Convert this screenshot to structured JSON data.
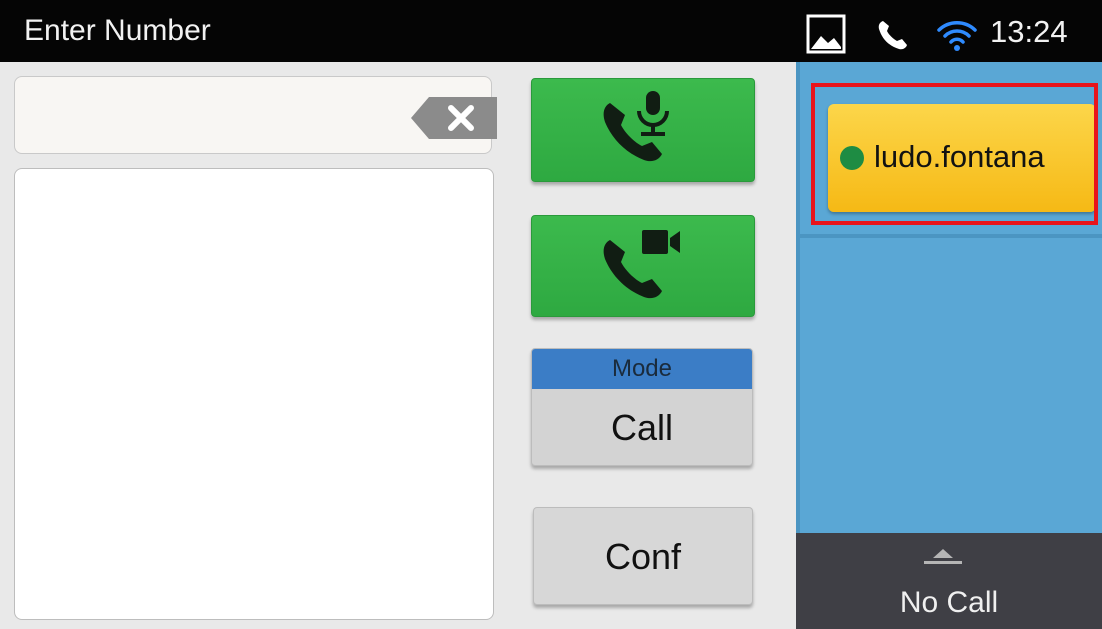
{
  "header": {
    "title": "Enter Number",
    "time": "13:24",
    "icons": [
      "gallery-icon",
      "phone-status-icon",
      "wifi-icon"
    ]
  },
  "dialer": {
    "number_value": "",
    "backspace_icon": "backspace-icon",
    "audio_call_icon": "phone-mic-icon",
    "video_call_icon": "phone-video-icon"
  },
  "mode": {
    "label": "Mode",
    "value": "Call"
  },
  "conf": {
    "label": "Conf"
  },
  "account": {
    "name": "ludo.fontana",
    "status_color": "#1e8c43",
    "button_color": "#f8c52a"
  },
  "call_status": {
    "label": "No Call"
  },
  "colors": {
    "call_button": "#35b247",
    "mode_header": "#3b7dc6",
    "right_panel": "#5aa7d5",
    "highlight": "#e8141b"
  }
}
